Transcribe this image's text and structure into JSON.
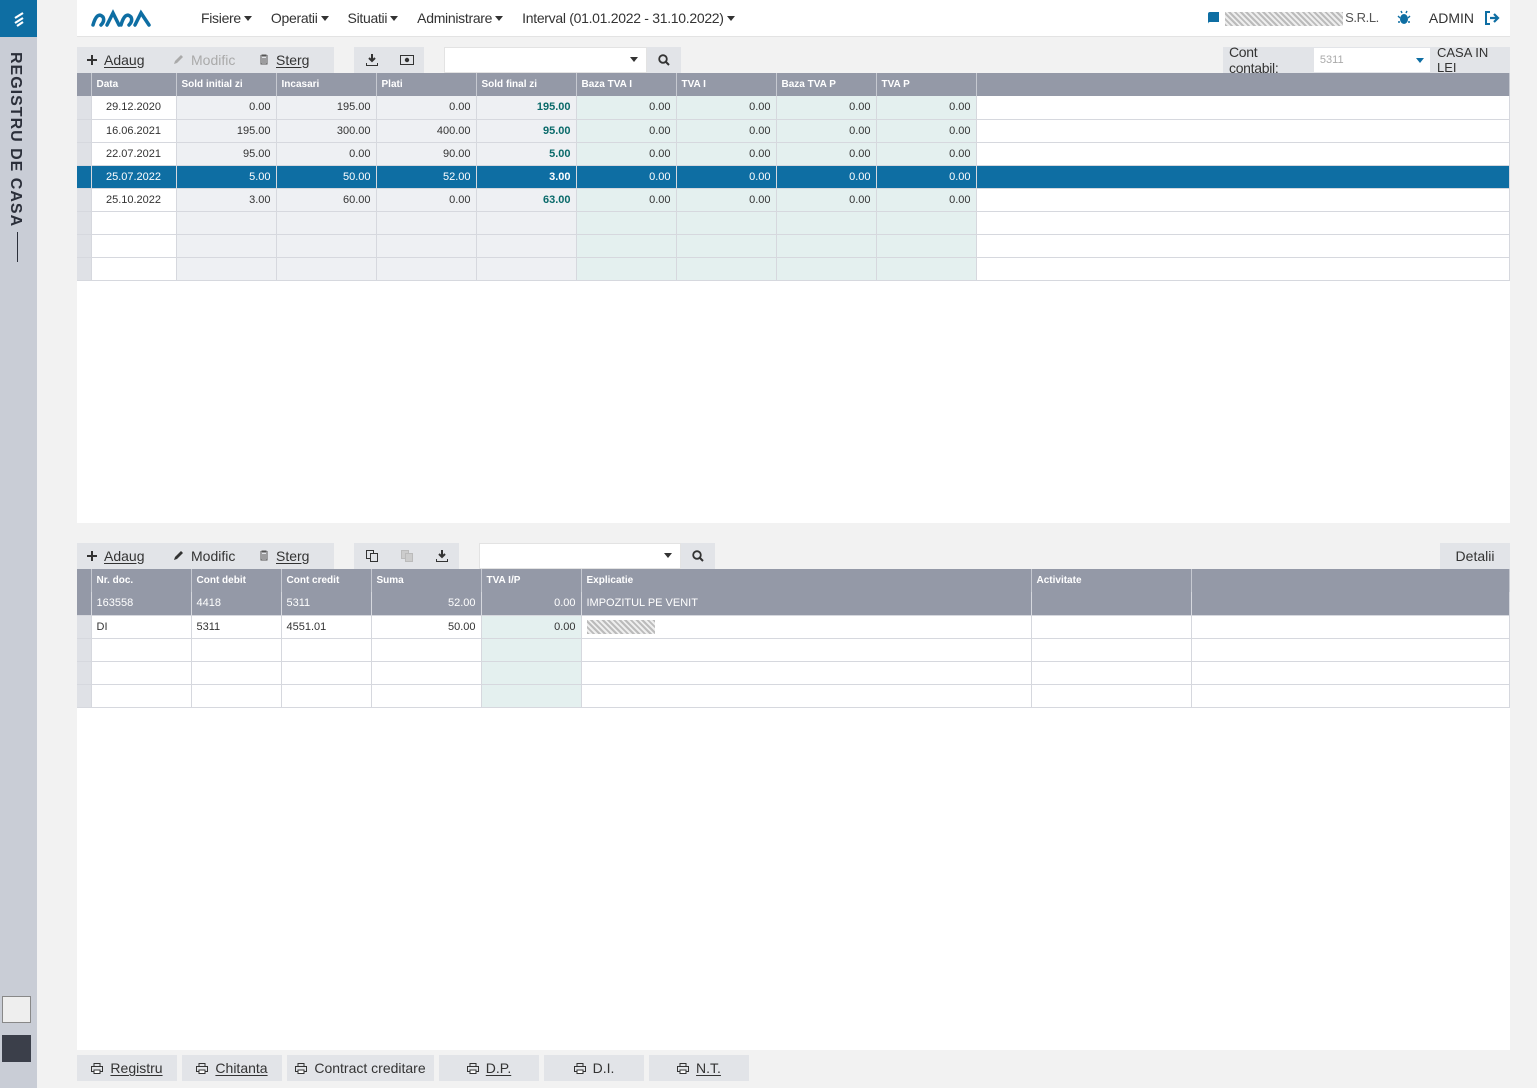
{
  "app": {
    "sidebar_title": "REGISTRU DE CASA",
    "brand": "saga"
  },
  "header": {
    "menu": [
      {
        "label": "Fisiere"
      },
      {
        "label": "Operatii"
      },
      {
        "label": "Situatii"
      },
      {
        "label": "Administrare"
      },
      {
        "label": "Interval (01.01.2022 - 31.10.2022)"
      }
    ],
    "company_suffix": "S.R.L.",
    "user": "ADMIN"
  },
  "top_toolbar": {
    "add": "Adaug",
    "edit": "Modific",
    "delete": "Sterg",
    "account_label": "Cont contabil:",
    "account_value": "5311",
    "currency_label": "CASA IN LEI"
  },
  "top_table": {
    "columns": [
      "Data",
      "Sold initial zi",
      "Incasari",
      "Plati",
      "Sold final zi",
      "Baza TVA I",
      "TVA I",
      "Baza TVA P",
      "TVA P"
    ],
    "rows": [
      [
        "29.12.2020",
        "0.00",
        "195.00",
        "0.00",
        "195.00",
        "0.00",
        "0.00",
        "0.00",
        "0.00"
      ],
      [
        "16.06.2021",
        "195.00",
        "300.00",
        "400.00",
        "95.00",
        "0.00",
        "0.00",
        "0.00",
        "0.00"
      ],
      [
        "22.07.2021",
        "95.00",
        "0.00",
        "90.00",
        "5.00",
        "0.00",
        "0.00",
        "0.00",
        "0.00"
      ],
      [
        "25.07.2022",
        "5.00",
        "50.00",
        "52.00",
        "3.00",
        "0.00",
        "0.00",
        "0.00",
        "0.00"
      ],
      [
        "25.10.2022",
        "3.00",
        "60.00",
        "0.00",
        "63.00",
        "0.00",
        "0.00",
        "0.00",
        "0.00"
      ]
    ],
    "selected_row": 3
  },
  "bottom_toolbar": {
    "add": "Adaug",
    "edit": "Modific",
    "delete": "Sterg",
    "details": "Detalii"
  },
  "bottom_table": {
    "columns": [
      "Nr. doc.",
      "Cont debit",
      "Cont credit",
      "Suma",
      "TVA I/P",
      "Explicatie",
      "Activitate"
    ],
    "rows": [
      [
        "163558",
        "4418",
        "5311",
        "52.00",
        "0.00",
        "IMPOZITUL PE VENIT",
        ""
      ],
      [
        "DI",
        "5311",
        "4551.01",
        "50.00",
        "0.00",
        "",
        ""
      ]
    ],
    "selected_row": 0
  },
  "footer": {
    "buttons": [
      "Registru",
      "Chitanta",
      "Contract creditare",
      "D.P.",
      "D.I.",
      "N.T."
    ]
  },
  "colors": {
    "accent": "#0e6ea3",
    "header_gray": "#9499a7",
    "bold_value": "#0a6a6a"
  }
}
